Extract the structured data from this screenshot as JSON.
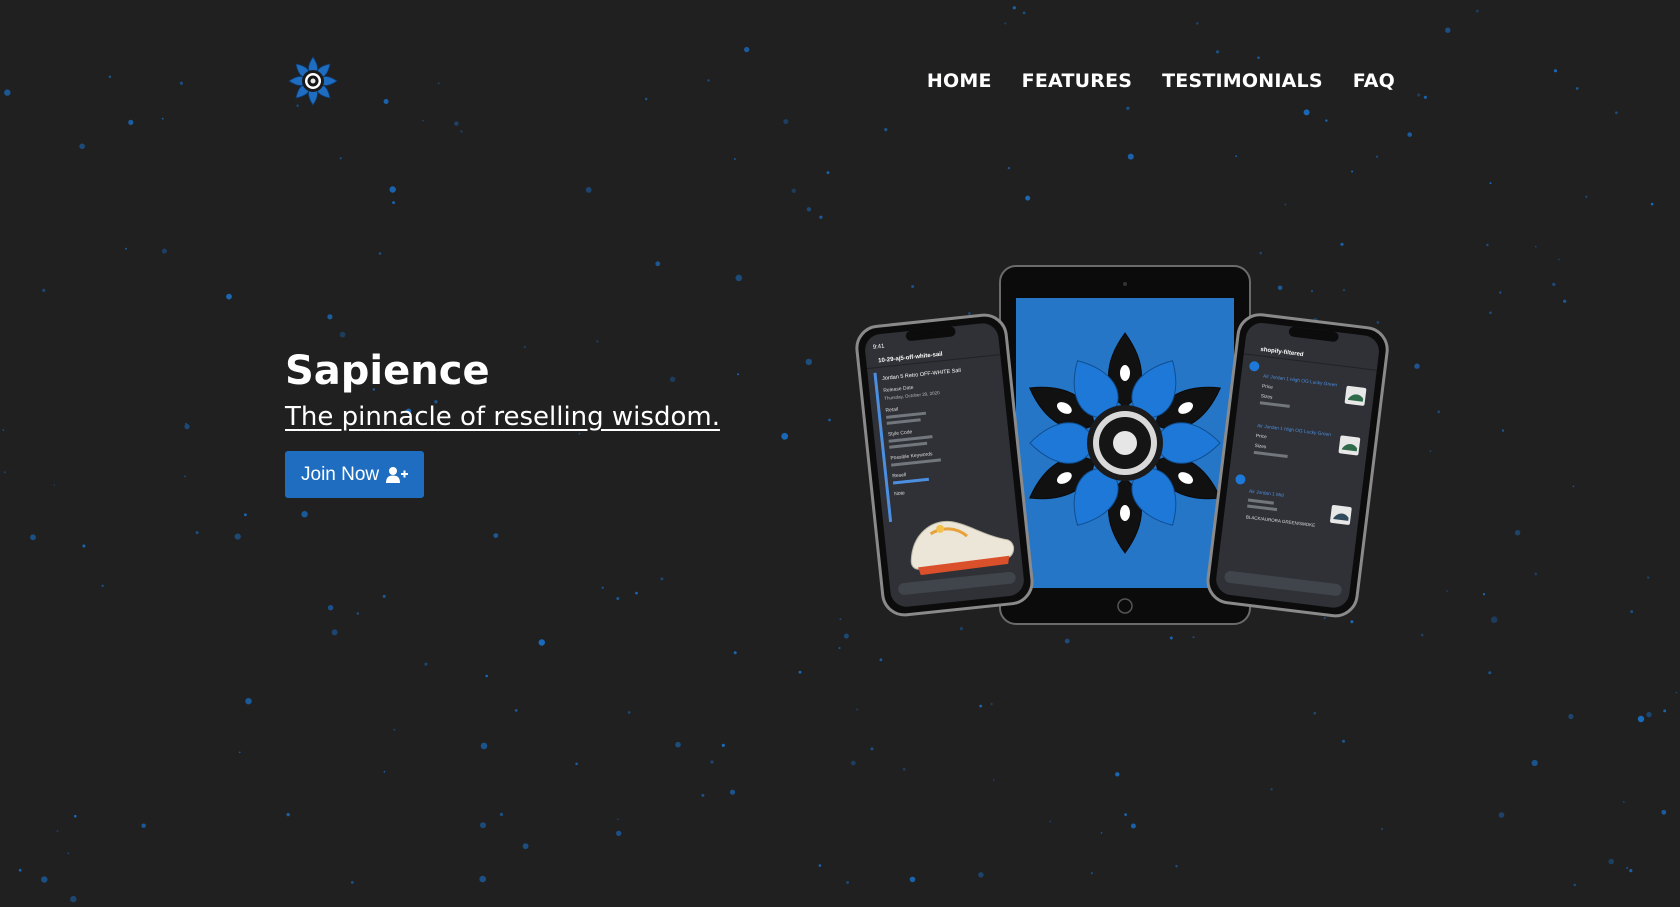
{
  "nav": {
    "items": [
      {
        "label": "HOME"
      },
      {
        "label": "FEATURES"
      },
      {
        "label": "TESTIMONIALS"
      },
      {
        "label": "FAQ"
      }
    ]
  },
  "hero": {
    "title": "Sapience",
    "tagline": "The pinnacle of reselling wisdom.",
    "cta_label": "Join Now"
  },
  "devices": {
    "left_phone": {
      "status_time": "9:41",
      "channel": "10-29-aj5-off-white-sail",
      "lines": [
        "Jordan 5 Retro OFF-WHITE Sail",
        "Release Date",
        "Thursday, October 29, 2020",
        "Retail",
        "Style Code",
        "Possible Keywords",
        "Resell",
        "Note"
      ]
    },
    "right_phone": {
      "channel": "shopify-filtered",
      "lines": [
        "Air Jordan 1 High OG Lucky Green",
        "Price",
        "Sizes",
        "Air Jordan 1 High OG Lucky Green",
        "Price",
        "Sizes",
        "Air Jordan 1 Mid",
        "BLACK/AURORA GREEN/SMOKE"
      ]
    }
  },
  "icons": {
    "logo": "sapience-flower-logo",
    "cta": "user-plus-icon"
  },
  "colors": {
    "background": "#202021",
    "accent": "#1e6dc0",
    "star": "#1a6fc4",
    "text": "#ffffff"
  }
}
